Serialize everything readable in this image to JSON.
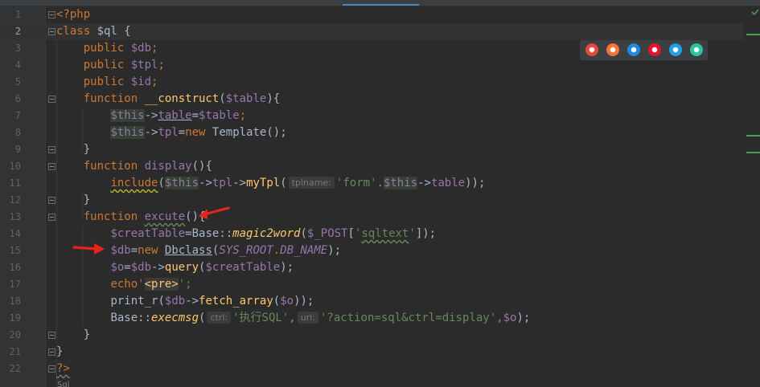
{
  "editor": {
    "language": "php",
    "current_line": "2",
    "lines": [
      {
        "num": "1",
        "tokens": [
          {
            "t": "<?php",
            "c": "kw"
          }
        ]
      },
      {
        "num": "2",
        "tokens": [
          {
            "t": "class ",
            "c": "kw"
          },
          {
            "t": "$ql",
            "c": "plain"
          },
          {
            "t": " {",
            "c": "plain"
          }
        ]
      },
      {
        "num": "3",
        "tokens": [
          {
            "t": "    public ",
            "c": "kw"
          },
          {
            "t": "$db",
            "c": "var"
          },
          {
            "t": ";",
            "c": "kw"
          }
        ]
      },
      {
        "num": "4",
        "tokens": [
          {
            "t": "    public ",
            "c": "kw"
          },
          {
            "t": "$tpl",
            "c": "var"
          },
          {
            "t": ";",
            "c": "kw"
          }
        ]
      },
      {
        "num": "5",
        "tokens": [
          {
            "t": "    public ",
            "c": "kw"
          },
          {
            "t": "$id",
            "c": "var"
          },
          {
            "t": ";",
            "c": "kw"
          }
        ]
      },
      {
        "num": "6",
        "tokens": [
          {
            "t": "    function ",
            "c": "kw"
          },
          {
            "t": "__construct",
            "c": "fn"
          },
          {
            "t": "(",
            "c": "plain"
          },
          {
            "t": "$table",
            "c": "var"
          },
          {
            "t": "){",
            "c": "plain"
          }
        ]
      },
      {
        "num": "7",
        "tokens": [
          {
            "t": "        ",
            "c": "plain"
          },
          {
            "t": "$this",
            "c": "this-hl"
          },
          {
            "t": "->",
            "c": "plain"
          },
          {
            "t": "table",
            "c": "fld under"
          },
          {
            "t": "=",
            "c": "plain"
          },
          {
            "t": "$table",
            "c": "var"
          },
          {
            "t": ";",
            "c": "kw"
          }
        ]
      },
      {
        "num": "8",
        "tokens": [
          {
            "t": "        ",
            "c": "plain"
          },
          {
            "t": "$this",
            "c": "this-hl"
          },
          {
            "t": "->",
            "c": "plain"
          },
          {
            "t": "tpl",
            "c": "fld"
          },
          {
            "t": "=",
            "c": "plain"
          },
          {
            "t": "new ",
            "c": "kw"
          },
          {
            "t": "Template",
            "c": "plain"
          },
          {
            "t": "();",
            "c": "plain"
          }
        ]
      },
      {
        "num": "9",
        "tokens": [
          {
            "t": "    }",
            "c": "plain"
          }
        ]
      },
      {
        "num": "10",
        "tokens": [
          {
            "t": "    function ",
            "c": "kw"
          },
          {
            "t": "display",
            "c": "fld"
          },
          {
            "t": "(){",
            "c": "plain"
          }
        ]
      },
      {
        "num": "11",
        "tokens": [
          {
            "t": "        ",
            "c": "plain"
          },
          {
            "t": "include",
            "c": "kw wavy-warn"
          },
          {
            "t": "(",
            "c": "plain"
          },
          {
            "t": "$this",
            "c": "this-hl"
          },
          {
            "t": "->",
            "c": "plain"
          },
          {
            "t": "tpl",
            "c": "fld"
          },
          {
            "t": "->",
            "c": "plain"
          },
          {
            "t": "myTpl",
            "c": "fn"
          },
          {
            "t": "(",
            "c": "plain"
          },
          {
            "hint": "tplname:"
          },
          {
            "t": "'form'",
            "c": "str"
          },
          {
            "t": ".",
            "c": "kw"
          },
          {
            "t": "$this",
            "c": "this-hl"
          },
          {
            "t": "->",
            "c": "plain"
          },
          {
            "t": "table",
            "c": "fld"
          },
          {
            "t": "));",
            "c": "plain"
          }
        ]
      },
      {
        "num": "12",
        "tokens": [
          {
            "t": "    }",
            "c": "plain"
          }
        ]
      },
      {
        "num": "13",
        "tokens": [
          {
            "t": "    function ",
            "c": "kw"
          },
          {
            "t": "excute",
            "c": "fld wavy"
          },
          {
            "t": "(){",
            "c": "plain"
          }
        ]
      },
      {
        "num": "14",
        "tokens": [
          {
            "t": "        ",
            "c": "plain"
          },
          {
            "t": "$creatTable",
            "c": "var"
          },
          {
            "t": "=",
            "c": "plain"
          },
          {
            "t": "Base",
            "c": "plain"
          },
          {
            "t": "::",
            "c": "plain"
          },
          {
            "t": "magic2word",
            "c": "fn itl"
          },
          {
            "t": "(",
            "c": "plain"
          },
          {
            "t": "$_POST",
            "c": "var"
          },
          {
            "t": "[",
            "c": "plain"
          },
          {
            "t": "'",
            "c": "str"
          },
          {
            "t": "sqltext",
            "c": "str wavy"
          },
          {
            "t": "'",
            "c": "str"
          },
          {
            "t": "]);",
            "c": "plain"
          }
        ]
      },
      {
        "num": "15",
        "tokens": [
          {
            "t": "        ",
            "c": "plain"
          },
          {
            "t": "$db",
            "c": "var"
          },
          {
            "t": "=",
            "c": "plain"
          },
          {
            "t": "new ",
            "c": "kw"
          },
          {
            "t": "Dbclass",
            "c": "plain under"
          },
          {
            "t": "(",
            "c": "plain"
          },
          {
            "t": "SYS_ROOT",
            "c": "var itl"
          },
          {
            "t": ".",
            "c": "kw"
          },
          {
            "t": "DB_NAME",
            "c": "var itl"
          },
          {
            "t": ");",
            "c": "plain"
          }
        ]
      },
      {
        "num": "16",
        "tokens": [
          {
            "t": "        ",
            "c": "plain"
          },
          {
            "t": "$o",
            "c": "var"
          },
          {
            "t": "=",
            "c": "plain"
          },
          {
            "t": "$db",
            "c": "var"
          },
          {
            "t": "->",
            "c": "plain"
          },
          {
            "t": "query",
            "c": "fn"
          },
          {
            "t": "(",
            "c": "plain"
          },
          {
            "t": "$creatTable",
            "c": "var"
          },
          {
            "t": ");",
            "c": "plain"
          }
        ]
      },
      {
        "num": "17",
        "tokens": [
          {
            "t": "        ",
            "c": "plain"
          },
          {
            "t": "echo",
            "c": "kw"
          },
          {
            "t": "'",
            "c": "str"
          },
          {
            "t": "<pre>",
            "c": "fn tag-hl"
          },
          {
            "t": "';",
            "c": "str"
          }
        ]
      },
      {
        "num": "18",
        "tokens": [
          {
            "t": "        ",
            "c": "plain"
          },
          {
            "t": "print_r",
            "c": "plain"
          },
          {
            "t": "(",
            "c": "plain"
          },
          {
            "t": "$db",
            "c": "var"
          },
          {
            "t": "->",
            "c": "plain"
          },
          {
            "t": "fetch_array",
            "c": "fn"
          },
          {
            "t": "(",
            "c": "plain"
          },
          {
            "t": "$o",
            "c": "var"
          },
          {
            "t": "));",
            "c": "plain"
          }
        ]
      },
      {
        "num": "19",
        "tokens": [
          {
            "t": "        ",
            "c": "plain"
          },
          {
            "t": "Base",
            "c": "plain"
          },
          {
            "t": "::",
            "c": "plain"
          },
          {
            "t": "execmsg",
            "c": "fn itl"
          },
          {
            "t": "(",
            "c": "plain"
          },
          {
            "hint": "ctrl:"
          },
          {
            "t": "'执行SQL'",
            "c": "str"
          },
          {
            "t": ",",
            "c": "kw"
          },
          {
            "hint": "url:"
          },
          {
            "t": "'?action=sql&ctrl=display'",
            "c": "str"
          },
          {
            "t": ",",
            "c": "kw"
          },
          {
            "t": "$o",
            "c": "var"
          },
          {
            "t": ");",
            "c": "plain"
          }
        ]
      },
      {
        "num": "20",
        "tokens": [
          {
            "t": "    }",
            "c": "plain"
          }
        ]
      },
      {
        "num": "21",
        "tokens": [
          {
            "t": "}",
            "c": "plain"
          }
        ]
      },
      {
        "num": "22",
        "tokens": [
          {
            "t": "?>",
            "c": "kw wavy"
          }
        ]
      }
    ]
  },
  "browser_icons": [
    {
      "name": "chrome-icon",
      "color": "#e8453c"
    },
    {
      "name": "firefox-icon",
      "color": "#ff7139"
    },
    {
      "name": "safari-icon",
      "color": "#1e88e5"
    },
    {
      "name": "opera-icon",
      "color": "#e8122c"
    },
    {
      "name": "ie-icon",
      "color": "#1ea0e6"
    },
    {
      "name": "edge-icon",
      "color": "#2bc4a3"
    }
  ],
  "annotations": [
    "red-arrow-line-13",
    "red-arrow-line-15"
  ]
}
